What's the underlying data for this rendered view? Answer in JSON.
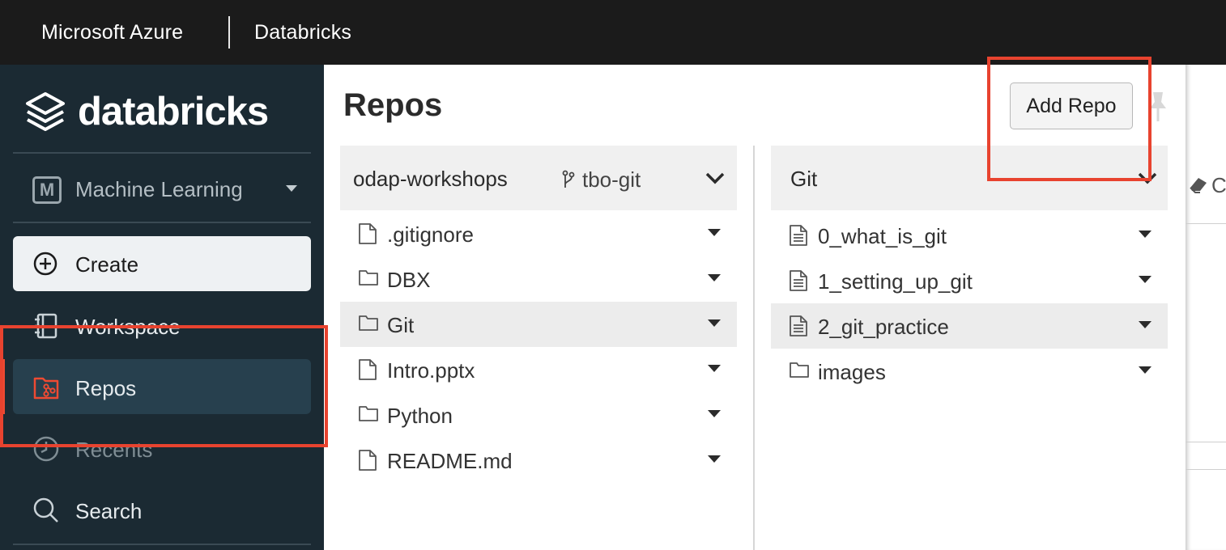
{
  "topbar": {
    "cloud": "Microsoft Azure",
    "product": "Databricks"
  },
  "sidebar": {
    "logo_text": "databricks",
    "persona": {
      "badge": "M",
      "label": "Machine Learning"
    },
    "create_label": "Create",
    "items": [
      {
        "label": "Workspace",
        "icon": "notebook-icon"
      },
      {
        "label": "Repos",
        "icon": "repo-folder-icon",
        "active": true
      },
      {
        "label": "Recents",
        "icon": "clock-icon"
      },
      {
        "label": "Search",
        "icon": "search-icon"
      }
    ]
  },
  "main": {
    "title": "Repos",
    "add_repo_label": "Add Repo",
    "left_column": {
      "name": "odap-workshops",
      "branch": "tbo-git",
      "rows": [
        {
          "label": ".gitignore",
          "type": "file"
        },
        {
          "label": "DBX",
          "type": "folder"
        },
        {
          "label": "Git",
          "type": "folder",
          "selected": true
        },
        {
          "label": "Intro.pptx",
          "type": "file"
        },
        {
          "label": "Python",
          "type": "folder"
        },
        {
          "label": "README.md",
          "type": "file"
        }
      ]
    },
    "right_column": {
      "name": "Git",
      "rows": [
        {
          "label": "0_what_is_git",
          "type": "notebook"
        },
        {
          "label": "1_setting_up_git",
          "type": "notebook"
        },
        {
          "label": "2_git_practice",
          "type": "notebook",
          "selected": true
        },
        {
          "label": "images",
          "type": "folder"
        }
      ]
    },
    "peek_text": "C"
  },
  "colors": {
    "accent": "#e8432f",
    "sidebar_bg": "#1b2a33",
    "topbar_bg": "#1b1b1b"
  }
}
